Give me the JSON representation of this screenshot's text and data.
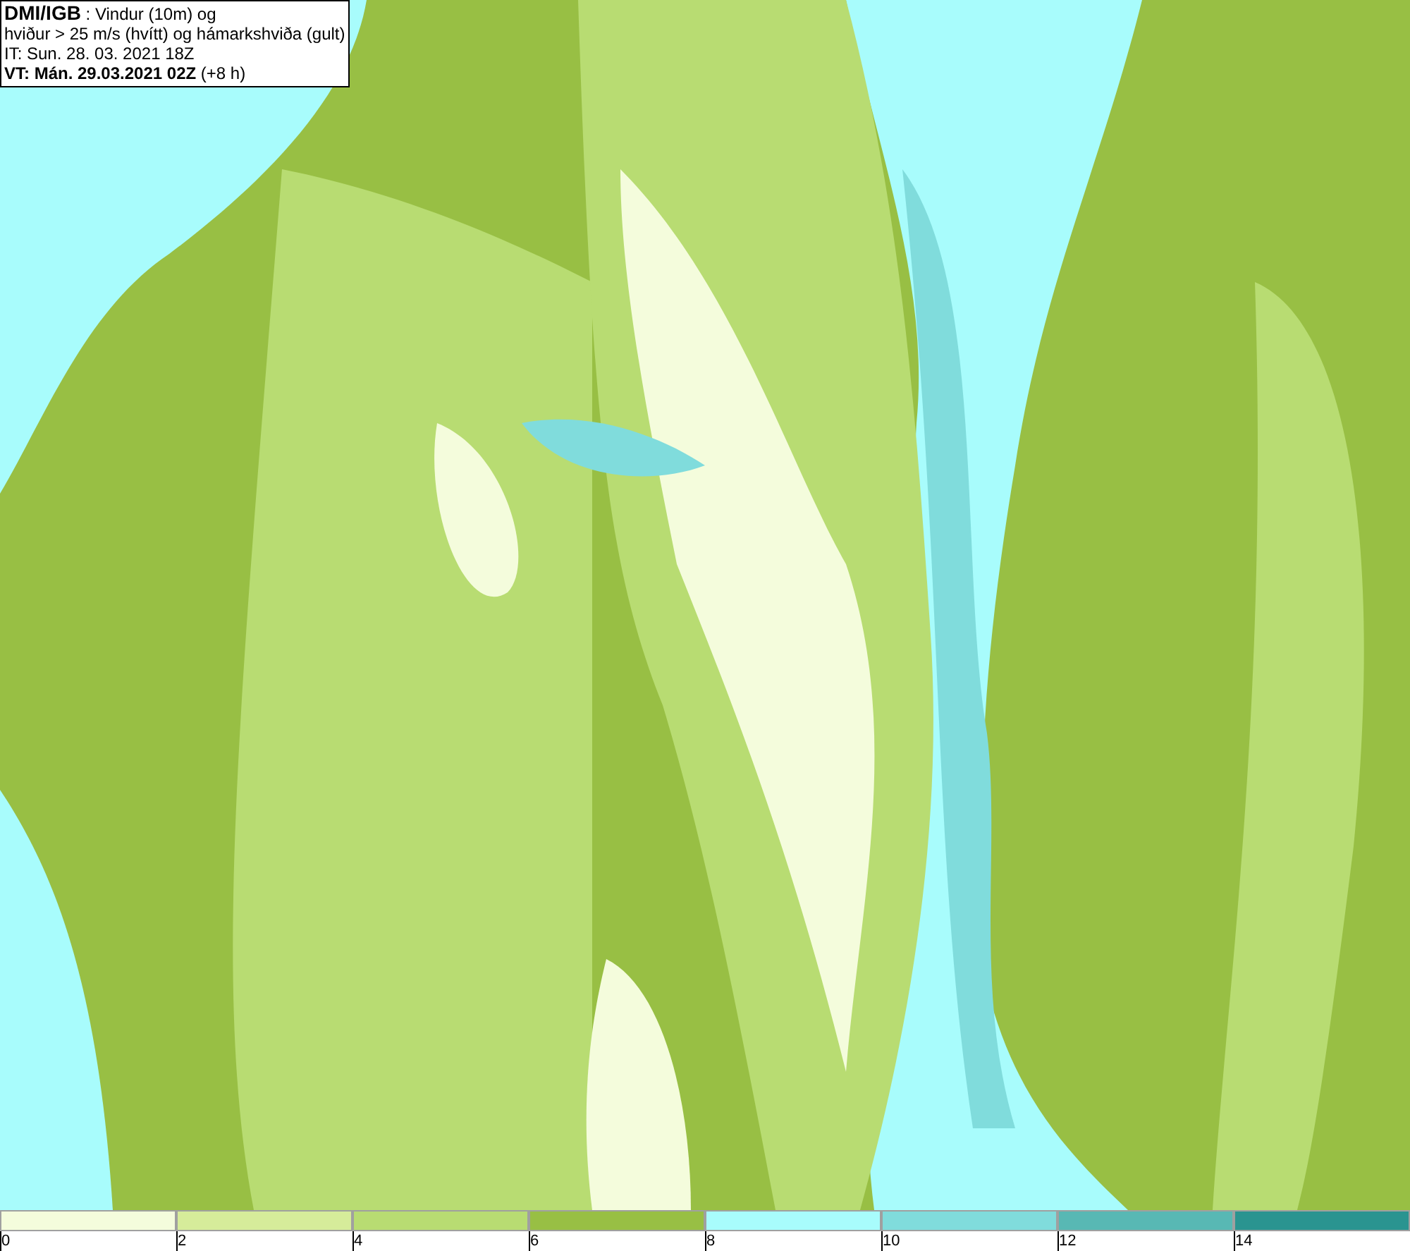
{
  "info_box": {
    "lines": [
      "**DMI/IGB** : Vindur (10m) og",
      "hviður > 25 m/s (hvítt) og hámarkshviða (gult)",
      "IT: Sun. 28. 03. 2021 18Z",
      "**VT: Mán. 29.03.2021 02Z** (+8 h)"
    ]
  },
  "legend": {
    "bins": [
      {
        "color": "#f4fcdc"
      },
      {
        "color": "#d6ec9a"
      },
      {
        "color": "#b8dc72"
      },
      {
        "color": "#98bf44"
      },
      {
        "color": "#a8fcfc"
      },
      {
        "color": "#80dcdc"
      },
      {
        "color": "#58b8b4"
      },
      {
        "color": "#2a9490"
      }
    ],
    "ticks": [
      "0",
      "2",
      "4",
      "6",
      "8",
      "10",
      "12",
      "14"
    ]
  }
}
